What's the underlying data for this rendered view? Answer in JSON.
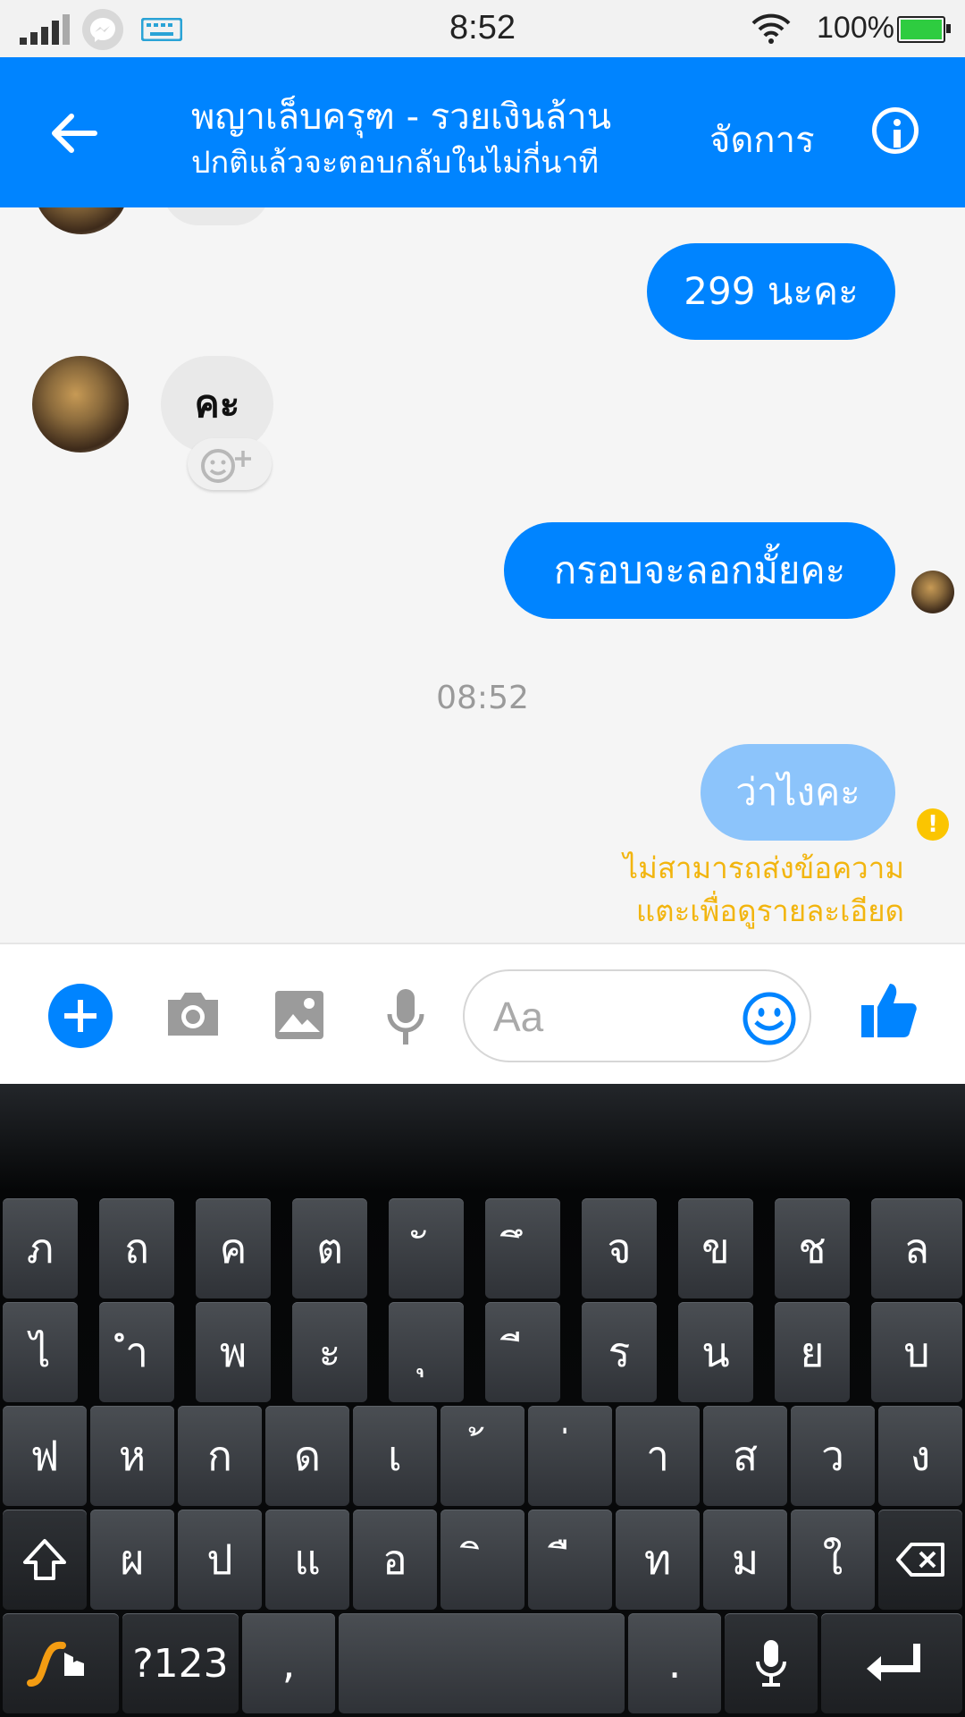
{
  "status_bar": {
    "time": "8:52",
    "battery": "100%"
  },
  "header": {
    "title": "พญาเล็บครุฑ - รวยเงินล้าน",
    "subtitle": "ปกติแล้วจะตอบกลับในไม่กี่นาที",
    "manage_label": "จัดการ"
  },
  "messages": {
    "m1": "299 นะคะ",
    "m2": "คะ",
    "m3": "กรอบจะลอกมั้ยคะ",
    "timestamp": "08:52",
    "m4": "ว่าไงคะ",
    "error_line1": "ไม่สามารถส่งข้อความ",
    "error_line2": "แตะเพื่อดูรายละเอียด"
  },
  "composer": {
    "placeholder": "Aa"
  },
  "keyboard": {
    "row1": [
      "ภ",
      "ถ",
      "ค",
      "ต",
      "ั",
      "ึ",
      "จ",
      "ข",
      "ช",
      "ล"
    ],
    "row2": [
      "ไ",
      "ำ",
      "พ",
      "ะ",
      "ุ",
      "ี",
      "ร",
      "น",
      "ย",
      "บ"
    ],
    "row3": [
      "ฟ",
      "ห",
      "ก",
      "ด",
      "เ",
      "้",
      "่",
      "า",
      "ส",
      "ว",
      "ง"
    ],
    "row4": [
      "ผ",
      "ป",
      "แ",
      "อ",
      "ิ",
      "ื",
      "ท",
      "ม",
      "ใ"
    ],
    "symbols": "?123",
    "comma": ",",
    "period": "."
  },
  "colors": {
    "accent": "#0084ff",
    "warning": "#fbc500"
  }
}
